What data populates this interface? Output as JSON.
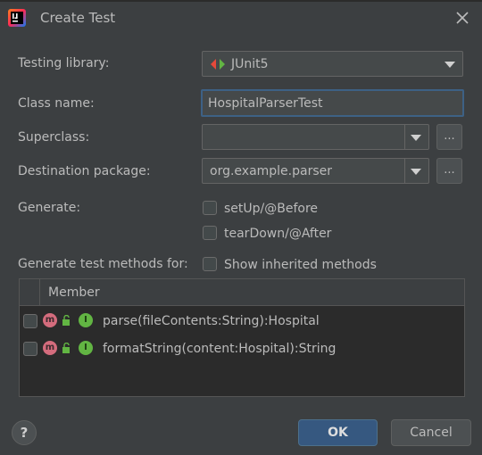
{
  "window": {
    "title": "Create Test"
  },
  "form": {
    "testing_library": {
      "label": "Testing library:",
      "value": "JUnit5"
    },
    "class_name": {
      "label": "Class name:",
      "value": "HospitalParserTest"
    },
    "superclass": {
      "label": "Superclass:",
      "value": "",
      "browse_label": "..."
    },
    "destination_package": {
      "label": "Destination package:",
      "value": "org.example.parser",
      "browse_label": "..."
    },
    "generate": {
      "label": "Generate:",
      "options": [
        {
          "label": "setUp/@Before",
          "checked": false
        },
        {
          "label": "tearDown/@After",
          "checked": false
        }
      ]
    },
    "methods_for": {
      "label": "Generate test methods for:",
      "show_inherited_label": "Show inherited methods"
    }
  },
  "table": {
    "header": "Member",
    "rows": [
      {
        "member": "parse(fileContents:String):Hospital",
        "checked": false
      },
      {
        "member": "formatString(content:Hospital):String",
        "checked": false
      }
    ]
  },
  "buttons": {
    "help": "?",
    "ok": "OK",
    "cancel": "Cancel"
  },
  "icons": {
    "method": "m",
    "implements": "I"
  },
  "colors": {
    "background": "#3c3f41",
    "accent": "#365880",
    "focus_border": "#3d6185",
    "method_icon": "#d46c7d",
    "interface_icon": "#62b543"
  }
}
